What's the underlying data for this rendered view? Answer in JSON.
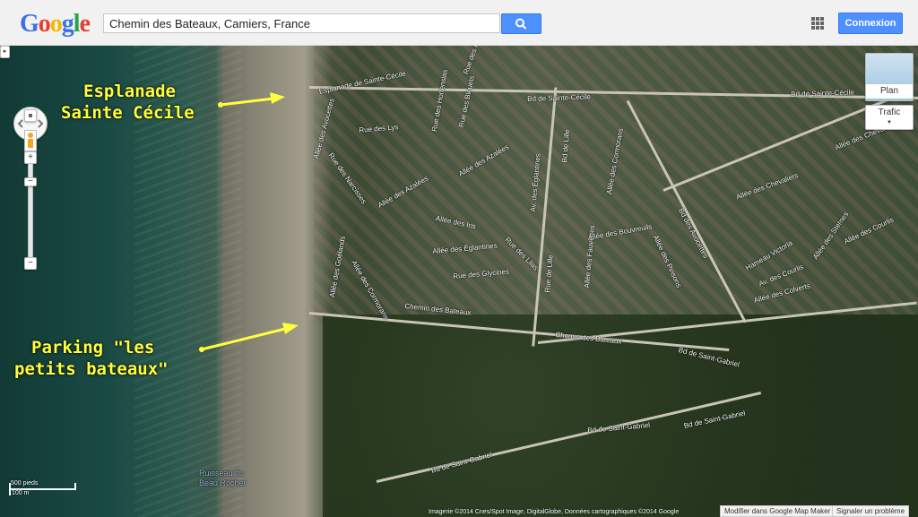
{
  "header": {
    "logo_letters": [
      "G",
      "o",
      "o",
      "g",
      "l",
      "e"
    ],
    "logo_colors": [
      "#3a6ff0",
      "#e53d30",
      "#f8b500",
      "#3a6ff0",
      "#2aa44a",
      "#e53d30"
    ],
    "search_value": "Chemin des Bateaux, Camiers, France",
    "search_icon": "magnifier-icon",
    "apps_icon": "apps-grid-icon",
    "signin_label": "Connexion"
  },
  "map_controls": {
    "layer_button_label": "Plan",
    "traffic_button_label": "Trafic",
    "zoom_in": "+",
    "zoom_out": "−",
    "zoom_out_bottom": "−"
  },
  "annotations": {
    "esplanade_line1": "Esplanade",
    "esplanade_line2": "Sainte Cécile",
    "parking_line1": "Parking \"les",
    "parking_line2": "petits bateaux\""
  },
  "road_labels": [
    "Esplanade de Sainte-Cécile",
    "Bd de Sainte-Cécile",
    "Bd de Sainte-Cécile",
    "Rue des Nations",
    "Rue des Hortensias",
    "Rue des Bleuets",
    "Rue des Lys",
    "Allée des Azalées",
    "Allée des Azalées",
    "Av. des Églantines",
    "Bd de Lille",
    "Allée des Iris",
    "Allée des Églantines",
    "Rue des Lilas",
    "Rue des Glycines",
    "Allée des Bouvreuils",
    "Allée des Fauvettes",
    "Allée des Cormorans",
    "Allée des Pinsons",
    "Bd des Avocettes",
    "Allée des Chevaliers",
    "Allée des Chevaliers",
    "Hameau Victoria",
    "Allée des Sternes",
    "Av. des Courlis",
    "Allée des Courlis",
    "Allée des Colverts",
    "Chemin des Bateaux",
    "Chemin des Bateaux",
    "Bd de Saint-Gabriel",
    "Bd de Saint-Gabriel",
    "Bd de Saint-Gabriel",
    "Bd de Saint-Gabriel",
    "Allée des Goélands",
    "Allée des Cormorans",
    "Allée des Avocettes",
    "Rue des Narcisses",
    "Rue de Lille"
  ],
  "places": {
    "ruisseau": "Ruisseau du",
    "beau_rocher": "Beau Rocher"
  },
  "scale": {
    "feet": "500 pieds",
    "meters": "100 m"
  },
  "footer": {
    "attribution": "Imagerie ©2014 Cnes/Spot Image, DigitalGlobe, Données cartographiques ©2014 Google",
    "report_edit": "Modifier dans Google Map Maker",
    "report_problem": "Signaler un problème"
  }
}
